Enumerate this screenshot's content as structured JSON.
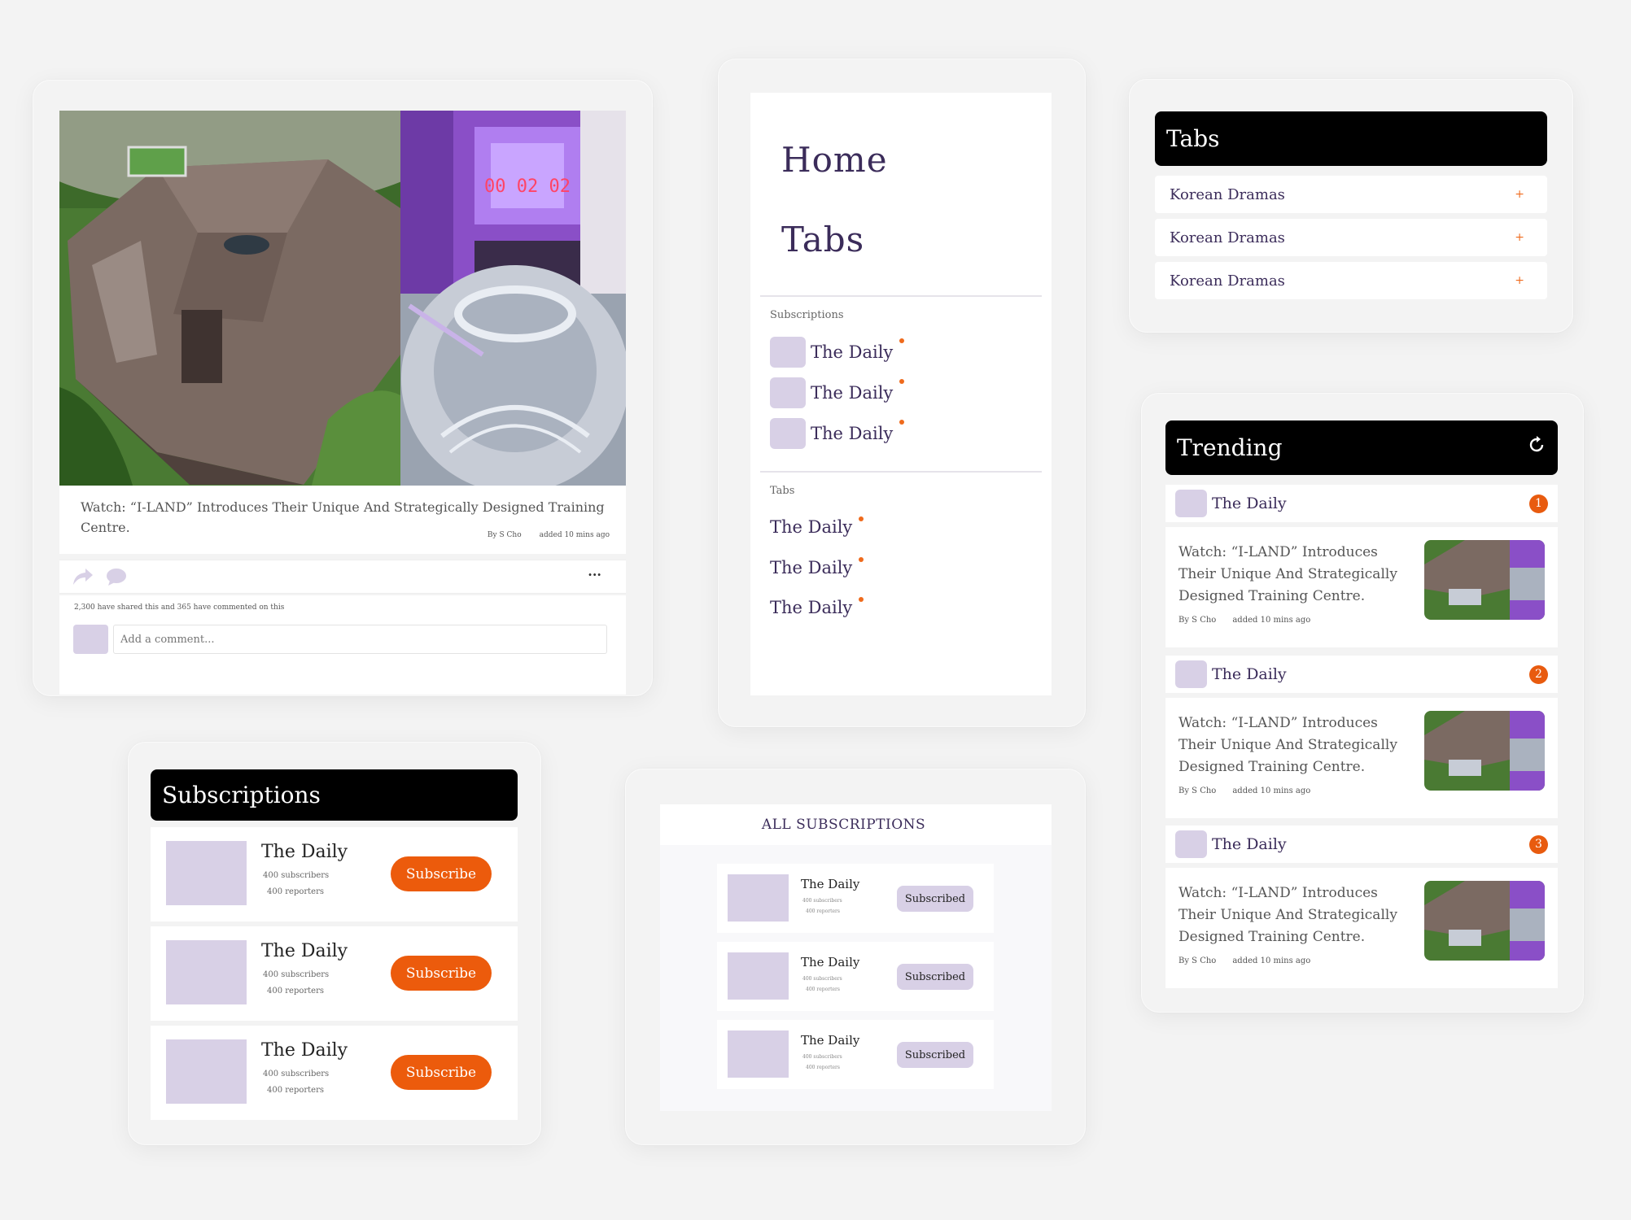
{
  "colors": {
    "accent": "#ec5b0c",
    "placeholder": "#d8d0e6",
    "text": "#3b2c5a",
    "bar": "#000000"
  },
  "post": {
    "caption": "Watch: “I-LAND” Introduces Their Unique And Strategically Designed Training Centre.",
    "author": "By S Cho",
    "time": "added 10 mins ago",
    "stats": "2,300 have shared this and 365 have commented on this",
    "comment_placeholder": "Add a comment...",
    "more": "···",
    "image_text": "00 02 02"
  },
  "nav": {
    "home": "Home",
    "tabs": "Tabs",
    "subscriptions_label": "Subscriptions",
    "subscriptions": [
      "The Daily",
      "The Daily",
      "The Daily"
    ],
    "tabs_label": "Tabs",
    "tab_items": [
      "The Daily",
      "The Daily",
      "The Daily"
    ]
  },
  "tabs": {
    "title": "Tabs",
    "items": [
      "Korean Dramas",
      "Korean Dramas",
      "Korean Dramas"
    ],
    "plus": "+"
  },
  "trending": {
    "title": "Trending",
    "items": [
      {
        "source": "The Daily",
        "rank": "1",
        "text": "Watch: “I-LAND” Introduces Their Unique And Strategically Designed Training Centre.",
        "author": "By S Cho",
        "time": "added 10 mins ago"
      },
      {
        "source": "The Daily",
        "rank": "2",
        "text": "Watch: “I-LAND” Introduces Their Unique And Strategically Designed Training Centre.",
        "author": "By S Cho",
        "time": "added 10 mins ago"
      },
      {
        "source": "The Daily",
        "rank": "3",
        "text": "Watch: “I-LAND” Introduces Their Unique And Strategically Designed Training Centre.",
        "author": "By S Cho",
        "time": "added 10 mins ago"
      }
    ]
  },
  "subscriptions": {
    "title": "Subscriptions",
    "items": [
      {
        "name": "The Daily",
        "subscribers": "400 subscribers",
        "reporters": "400 reporters",
        "button": "Subscribe"
      },
      {
        "name": "The Daily",
        "subscribers": "400 subscribers",
        "reporters": "400 reporters",
        "button": "Subscribe"
      },
      {
        "name": "The Daily",
        "subscribers": "400 subscribers",
        "reporters": "400 reporters",
        "button": "Subscribe"
      }
    ]
  },
  "all_subscriptions": {
    "title": "ALL SUBSCRIPTIONS",
    "items": [
      {
        "name": "The Daily",
        "subscribers": "400 subscribers",
        "reporters": "400 reporters",
        "button": "Subscribed"
      },
      {
        "name": "The Daily",
        "subscribers": "400 subscribers",
        "reporters": "400 reporters",
        "button": "Subscribed"
      },
      {
        "name": "The Daily",
        "subscribers": "400 subscribers",
        "reporters": "400 reporters",
        "button": "Subscribed"
      }
    ]
  }
}
